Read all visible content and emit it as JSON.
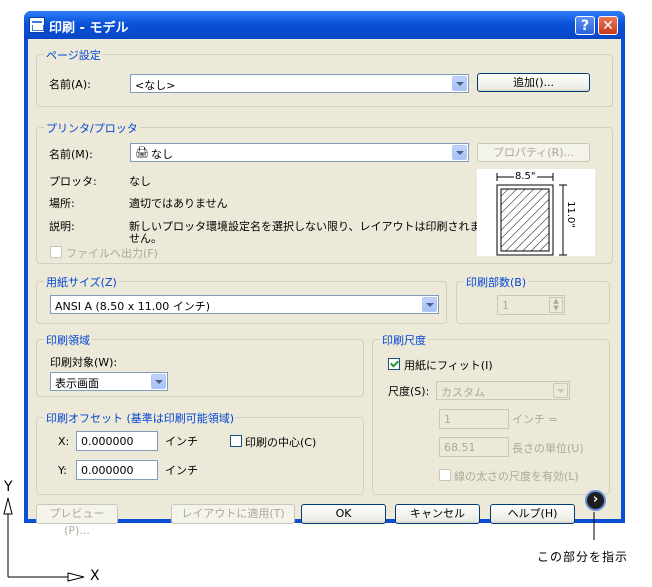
{
  "window": {
    "title": "印刷 - モデル",
    "help_button": "?",
    "close_button": "✕"
  },
  "page_setup": {
    "group_label": "ページ設定",
    "name_label": "名前(A):",
    "name_value": "<なし>",
    "add_button": "追加()..."
  },
  "printer": {
    "group_label": "プリンタ/プロッタ",
    "name_label": "名前(M):",
    "name_value": "なし",
    "properties_button": "プロパティ(R)...",
    "plotter_label": "プロッタ:",
    "plotter_value": "なし",
    "where_label": "場所:",
    "where_value": "適切ではありません",
    "description_label": "説明:",
    "description_line1": "新しいプロッタ環境設定名を選択しない限り、レイアウトは印刷されま",
    "description_line2": "せん。",
    "plot_to_file": "ファイルへ出力(F)",
    "preview_width": "8.5\"",
    "preview_height": "11.0\""
  },
  "paper_size": {
    "group_label": "用紙サイズ(Z)",
    "value": "ANSI A (8.50 x 11.00 インチ)"
  },
  "copies": {
    "group_label": "印刷部数(B)",
    "value": "1"
  },
  "plot_area": {
    "group_label": "印刷領域",
    "what_label": "印刷対象(W):",
    "value": "表示画面"
  },
  "plot_offset": {
    "group_label": "印刷オフセット (基準は印刷可能領域)",
    "x_label": "X:",
    "x_value": "0.000000",
    "x_unit": "インチ",
    "y_label": "Y:",
    "y_value": "0.000000",
    "y_unit": "インチ",
    "center_label": "印刷の中心(C)"
  },
  "plot_scale": {
    "group_label": "印刷尺度",
    "fit_label": "用紙にフィット(I)",
    "scale_label": "尺度(S):",
    "scale_value": "カスタム",
    "value1": "1",
    "unit1": "インチ =",
    "value2": "68.51",
    "unit2": "長さの単位(U)",
    "lineweights_label": "線の太さの尺度を有効(L)"
  },
  "buttons": {
    "preview": "プレビュー(P)...",
    "apply_layout": "レイアウトに適用(T)",
    "ok": "OK",
    "cancel": "キャンセル",
    "help": "ヘルプ(H)",
    "more": "›"
  },
  "annotation": {
    "text": "この部分を指示",
    "axis_x": "X",
    "axis_y": "Y"
  }
}
